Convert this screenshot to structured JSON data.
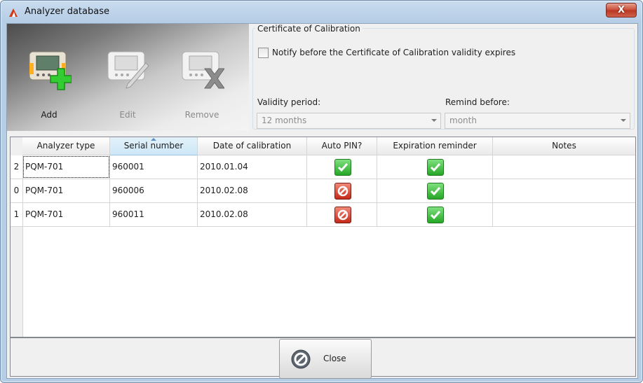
{
  "window": {
    "title": "Analyzer database",
    "close_glyph": "X"
  },
  "toolbar": {
    "add_label": "Add",
    "edit_label": "Edit",
    "remove_label": "Remove"
  },
  "certificate": {
    "group_title": "Certificate of Calibration",
    "notify_label": "Notify before the Certificate of Calibration validity expires",
    "notify_checked": false,
    "validity_label": "Validity period:",
    "validity_value": "12 months",
    "remind_label": "Remind before:",
    "remind_value": "month"
  },
  "table": {
    "columns": [
      "Analyzer type",
      "Serial number",
      "Date of calibration",
      "Auto PIN?",
      "Expiration reminder",
      "Notes"
    ],
    "sorted_column": "Serial number",
    "rows": [
      {
        "idx": "2",
        "type": "PQM-701",
        "serial": "960001",
        "date": "2010.01.04",
        "auto_pin": "ok",
        "reminder": "ok",
        "notes": ""
      },
      {
        "idx": "0",
        "type": "PQM-701",
        "serial": "960006",
        "date": "2010.02.08",
        "auto_pin": "no",
        "reminder": "ok",
        "notes": ""
      },
      {
        "idx": "1",
        "type": "PQM-701",
        "serial": "960011",
        "date": "2010.02.08",
        "auto_pin": "no",
        "reminder": "ok",
        "notes": ""
      }
    ]
  },
  "footer": {
    "close_label": "Close"
  },
  "colors": {
    "ok": "#26a626",
    "no": "#c42a1a",
    "sort_header": "#cde7f7"
  }
}
